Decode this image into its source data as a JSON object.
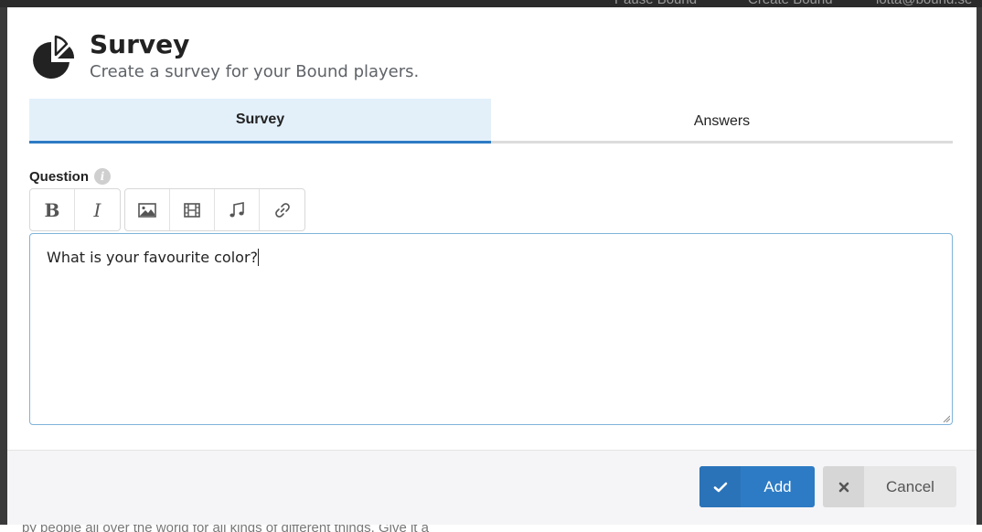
{
  "backdrop": {
    "top_text_1": "Pause Bound",
    "top_text_2": "Create Bound",
    "top_text_3": "lotta@bound.se",
    "bottom_text": "by people all over the world for all kinds of different things. Give it a"
  },
  "modal": {
    "icon": "pie-chart-icon",
    "title": "Survey",
    "subtitle": "Create a survey for your Bound players."
  },
  "tabs": [
    {
      "label": "Survey",
      "active": true
    },
    {
      "label": "Answers",
      "active": false
    }
  ],
  "question": {
    "label": "Question",
    "info_icon": "info-icon"
  },
  "toolbar": {
    "bold": "B",
    "italic": "I",
    "icons": [
      "image-icon",
      "film-icon",
      "music-icon",
      "link-icon"
    ]
  },
  "editor": {
    "value": "What is your favourite color?"
  },
  "footer": {
    "add_label": "Add",
    "cancel_label": "Cancel"
  },
  "colors": {
    "accent": "#2d7bc4",
    "active_tab_bg": "#e3f0fa"
  }
}
